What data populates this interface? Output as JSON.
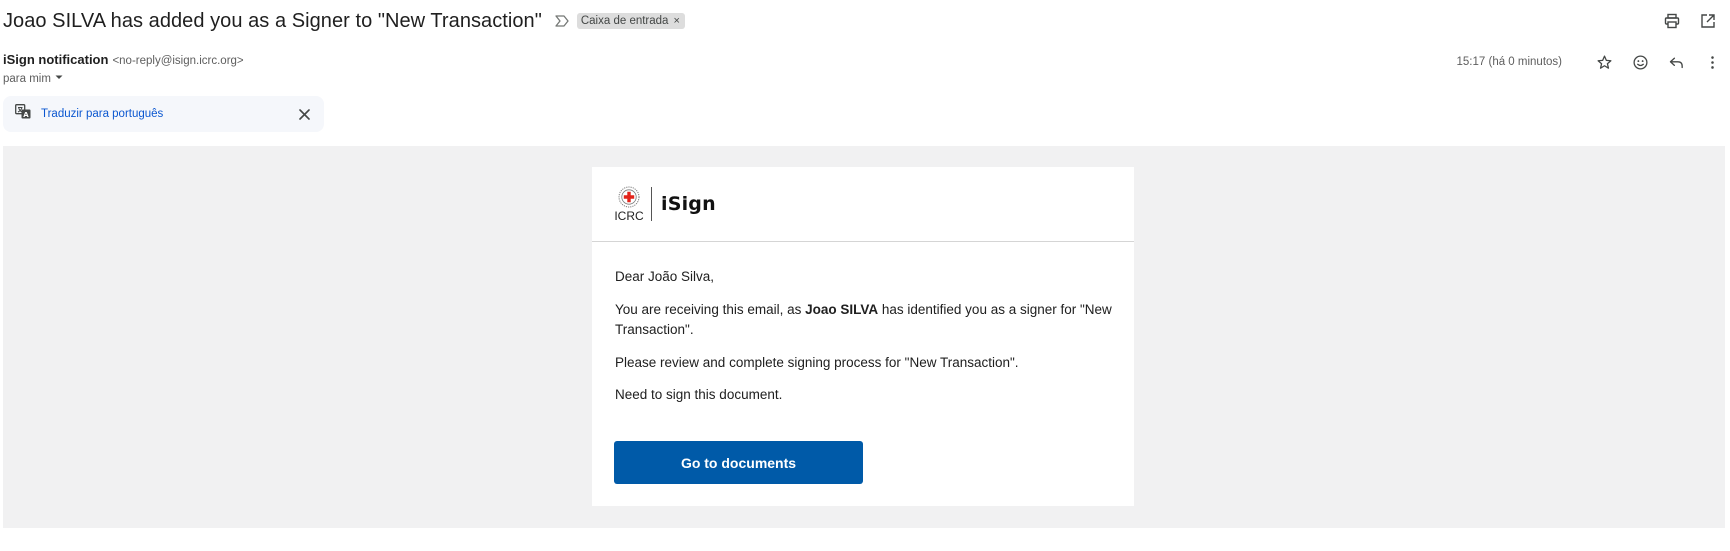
{
  "email": {
    "subject": "Joao SILVA has added you as a Signer to \"New Transaction\"",
    "label": "Caixa de entrada",
    "label_remove": "×",
    "sender_name": "iSign notification",
    "sender_email": "<no-reply@isign.icrc.org>",
    "to": "para mim",
    "timestamp": "15:17 (há 0 minutos)"
  },
  "icons": {
    "important": "important-marker-icon",
    "print": "print-icon",
    "open_new_window": "open-in-new-window-icon",
    "star": "star-icon",
    "emoji": "emoji-icon",
    "reply": "reply-icon",
    "more": "more-vert-icon",
    "translate": "translate-icon",
    "close": "close-icon",
    "dropdown": "chevron-down-icon",
    "logo": "red-cross-emblem-icon"
  },
  "translate_bar": {
    "link": "Traduzir para português"
  },
  "message": {
    "logo_text": "ICRC",
    "product_name": "iSign",
    "greeting": "Dear João Silva,",
    "para1_before": "You are receiving this email, as ",
    "para1_bold": "Joao SILVA",
    "para1_after": " has identified you as a signer for \"New Transaction\".",
    "para2": "Please review and complete signing process for \"New Transaction\".",
    "para3": "Need to sign this document.",
    "cta_label": "Go to documents"
  },
  "colors": {
    "cta": "#005aa8",
    "link": "#0b57d0",
    "canvas": "#f1f1f2",
    "logo_red": "#e2231a"
  }
}
